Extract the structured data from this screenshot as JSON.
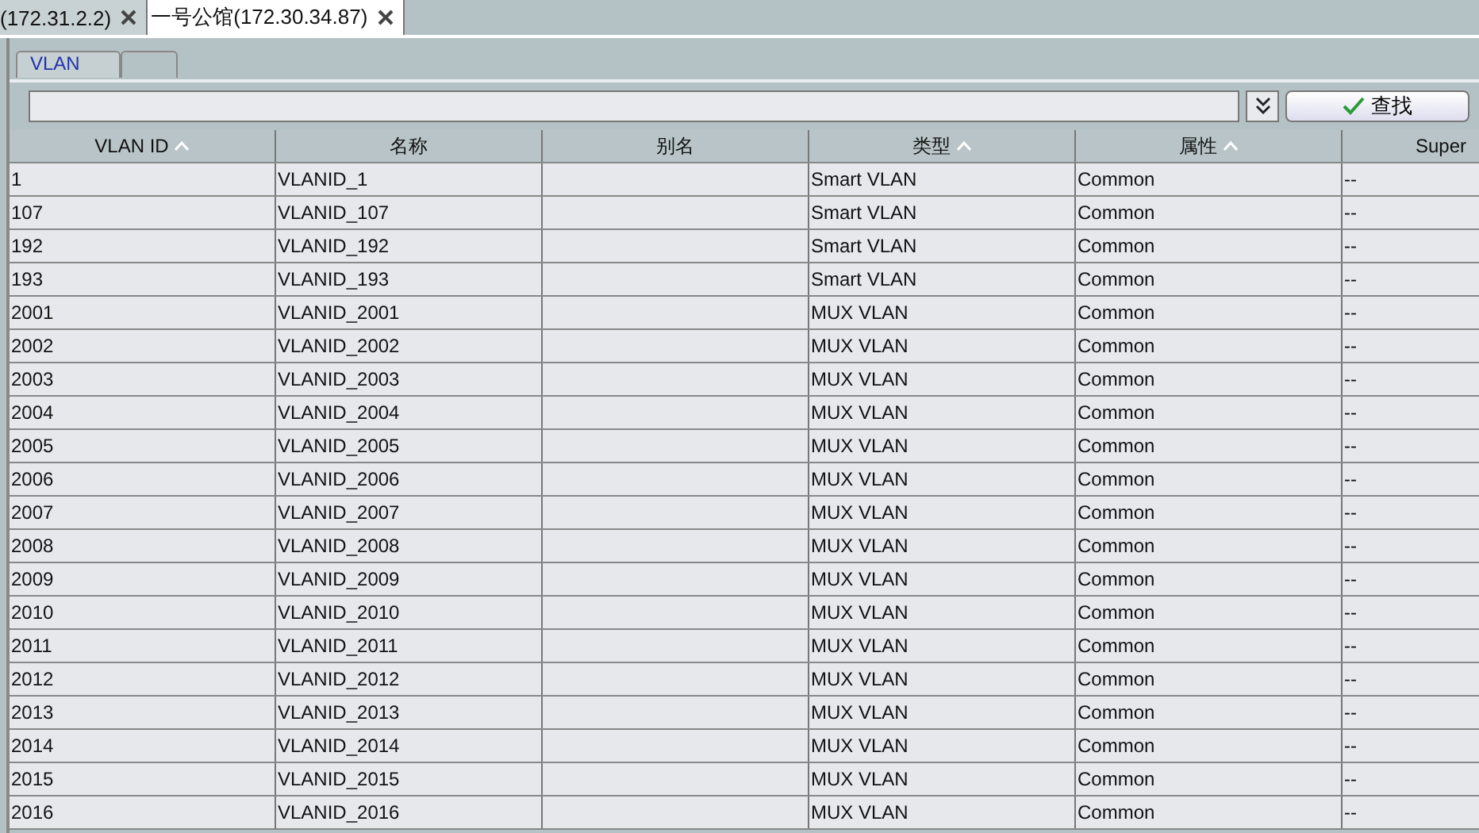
{
  "tabs": [
    {
      "label": "(172.31.2.2)",
      "selected": false
    },
    {
      "label": "一号公馆(172.30.34.87)",
      "selected": true
    }
  ],
  "subtabs": [
    {
      "label": "VLAN",
      "selected": true
    },
    {
      "selected": false
    }
  ],
  "search": {
    "button": "查找"
  },
  "table": {
    "columns": [
      {
        "label": "VLAN ID",
        "sorted": true
      },
      {
        "label": "名称",
        "sorted": false
      },
      {
        "label": "别名",
        "sorted": false
      },
      {
        "label": "类型",
        "sorted": true
      },
      {
        "label": "属性",
        "sorted": true
      },
      {
        "label": "Super",
        "sorted": false
      }
    ],
    "rows": [
      [
        "1",
        "VLANID_1",
        "",
        "Smart VLAN",
        "Common",
        "--"
      ],
      [
        "107",
        "VLANID_107",
        "",
        "Smart VLAN",
        "Common",
        "--"
      ],
      [
        "192",
        "VLANID_192",
        "",
        "Smart VLAN",
        "Common",
        "--"
      ],
      [
        "193",
        "VLANID_193",
        "",
        "Smart VLAN",
        "Common",
        "--"
      ],
      [
        "2001",
        "VLANID_2001",
        "",
        "MUX VLAN",
        "Common",
        "--"
      ],
      [
        "2002",
        "VLANID_2002",
        "",
        "MUX VLAN",
        "Common",
        "--"
      ],
      [
        "2003",
        "VLANID_2003",
        "",
        "MUX VLAN",
        "Common",
        "--"
      ],
      [
        "2004",
        "VLANID_2004",
        "",
        "MUX VLAN",
        "Common",
        "--"
      ],
      [
        "2005",
        "VLANID_2005",
        "",
        "MUX VLAN",
        "Common",
        "--"
      ],
      [
        "2006",
        "VLANID_2006",
        "",
        "MUX VLAN",
        "Common",
        "--"
      ],
      [
        "2007",
        "VLANID_2007",
        "",
        "MUX VLAN",
        "Common",
        "--"
      ],
      [
        "2008",
        "VLANID_2008",
        "",
        "MUX VLAN",
        "Common",
        "--"
      ],
      [
        "2009",
        "VLANID_2009",
        "",
        "MUX VLAN",
        "Common",
        "--"
      ],
      [
        "2010",
        "VLANID_2010",
        "",
        "MUX VLAN",
        "Common",
        "--"
      ],
      [
        "2011",
        "VLANID_2011",
        "",
        "MUX VLAN",
        "Common",
        "--"
      ],
      [
        "2012",
        "VLANID_2012",
        "",
        "MUX VLAN",
        "Common",
        "--"
      ],
      [
        "2013",
        "VLANID_2013",
        "",
        "MUX VLAN",
        "Common",
        "--"
      ],
      [
        "2014",
        "VLANID_2014",
        "",
        "MUX VLAN",
        "Common",
        "--"
      ],
      [
        "2015",
        "VLANID_2015",
        "",
        "MUX VLAN",
        "Common",
        "--"
      ],
      [
        "2016",
        "VLANID_2016",
        "",
        "MUX VLAN",
        "Common",
        "--"
      ]
    ]
  }
}
